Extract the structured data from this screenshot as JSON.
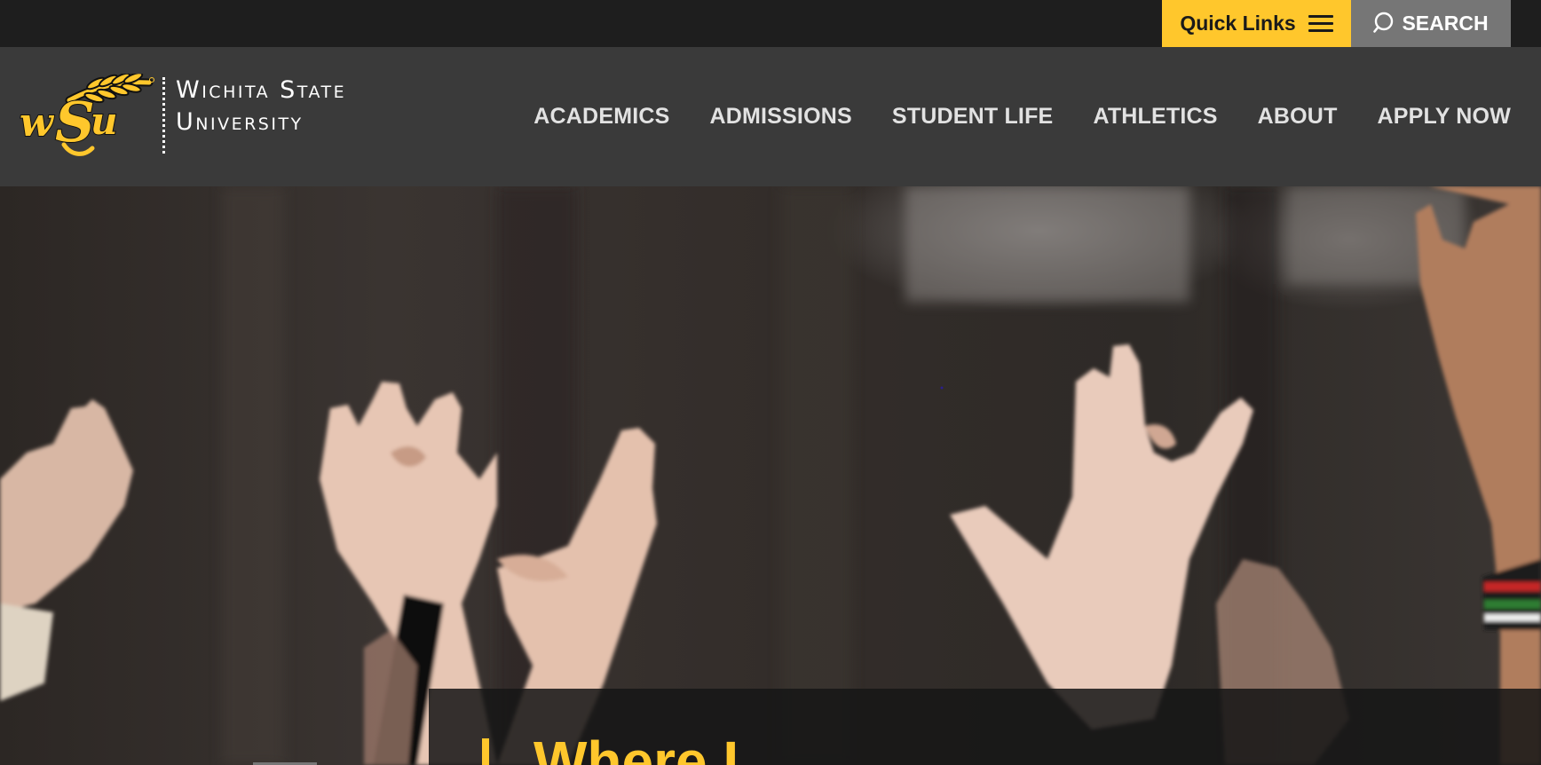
{
  "utility_bar": {
    "quick_links_label": "Quick Links",
    "search_label": "SEARCH"
  },
  "logo": {
    "line1": "Wichita State",
    "line2": "University",
    "monogram_icon": "wsu-shocker-wheat-logo"
  },
  "nav": {
    "items": [
      {
        "label": "ACADEMICS"
      },
      {
        "label": "ADMISSIONS"
      },
      {
        "label": "STUDENT LIFE"
      },
      {
        "label": "ATHLETICS"
      },
      {
        "label": "ABOUT"
      },
      {
        "label": "APPLY NOW"
      }
    ]
  },
  "hero": {
    "headline": "Where I"
  },
  "colors": {
    "brand_yellow": "#ffc72c",
    "utility_bar": "#1e1e1e",
    "nav_bar": "#3a3a3a",
    "search_button": "#767676"
  }
}
